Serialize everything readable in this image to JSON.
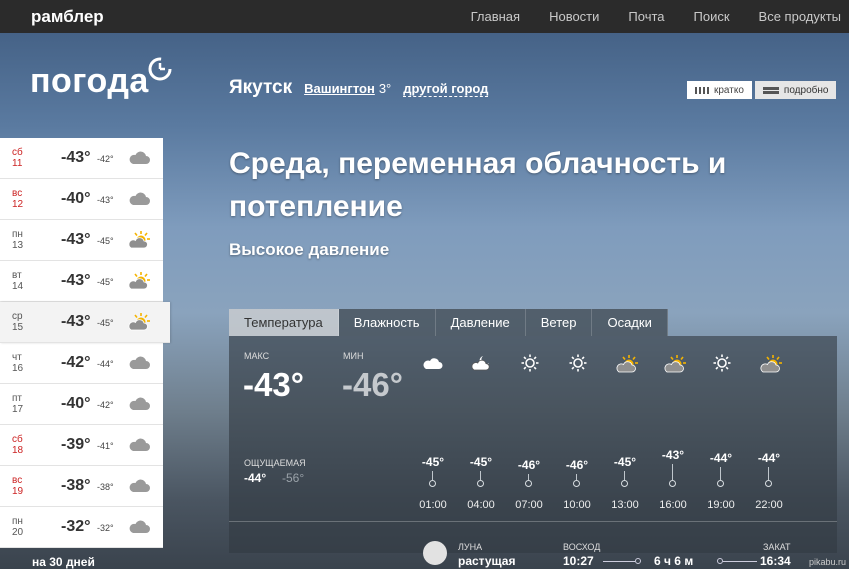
{
  "topbar": {
    "brand": "рамблер",
    "nav": [
      "Главная",
      "Новости",
      "Почта",
      "Поиск",
      "Все продукты"
    ]
  },
  "logo": "погода",
  "location": {
    "city": "Якутск",
    "alt_city": "Вашингтон",
    "alt_temp": "3°",
    "other_city": "другой город"
  },
  "view_toggle": {
    "short": "кратко",
    "detailed": "подробно"
  },
  "headline": "Среда, переменная облачность и потепление",
  "pressure_note": "Высокое давление",
  "days": [
    {
      "day": "сб",
      "date": "11",
      "max": "-43°",
      "min": "-42°",
      "icon": "cloud-icon",
      "weekend": true
    },
    {
      "day": "вс",
      "date": "12",
      "max": "-40°",
      "min": "-43°",
      "icon": "cloud-icon",
      "weekend": true
    },
    {
      "day": "пн",
      "date": "13",
      "max": "-43°",
      "min": "-45°",
      "icon": "partly-sunny-icon",
      "weekend": false
    },
    {
      "day": "вт",
      "date": "14",
      "max": "-43°",
      "min": "-45°",
      "icon": "partly-sunny-icon",
      "weekend": false
    },
    {
      "day": "ср",
      "date": "15",
      "max": "-43°",
      "min": "-45°",
      "icon": "partly-sunny-icon",
      "weekend": false
    },
    {
      "day": "чт",
      "date": "16",
      "max": "-42°",
      "min": "-44°",
      "icon": "cloud-icon",
      "weekend": false
    },
    {
      "day": "пт",
      "date": "17",
      "max": "-40°",
      "min": "-42°",
      "icon": "cloud-icon",
      "weekend": false
    },
    {
      "day": "сб",
      "date": "18",
      "max": "-39°",
      "min": "-41°",
      "icon": "cloud-icon",
      "weekend": true
    },
    {
      "day": "вс",
      "date": "19",
      "max": "-38°",
      "min": "-38°",
      "icon": "cloud-icon",
      "weekend": true
    },
    {
      "day": "пн",
      "date": "20",
      "max": "-32°",
      "min": "-32°",
      "icon": "cloud-icon",
      "weekend": false
    }
  ],
  "active_day_index": 4,
  "month_link": "на 30 дней",
  "tabs": [
    "Температура",
    "Влажность",
    "Давление",
    "Ветер",
    "Осадки"
  ],
  "panel": {
    "max_label": "МАКС",
    "max_value": "-43°",
    "min_label": "МИН",
    "min_value": "-46°",
    "feels_label": "ОЩУЩАЕМАЯ",
    "feels_max": "-44°",
    "feels_min": "-56°"
  },
  "hourly": [
    {
      "time": "01:00",
      "temp": "-45°",
      "icon": "cloud-night-icon"
    },
    {
      "time": "04:00",
      "temp": "-45°",
      "icon": "moon-cloud-icon"
    },
    {
      "time": "07:00",
      "temp": "-46°",
      "icon": "sun-icon"
    },
    {
      "time": "10:00",
      "temp": "-46°",
      "icon": "sun-icon"
    },
    {
      "time": "13:00",
      "temp": "-45°",
      "icon": "partly-sunny-icon"
    },
    {
      "time": "16:00",
      "temp": "-43°",
      "icon": "partly-sunny-icon"
    },
    {
      "time": "19:00",
      "temp": "-44°",
      "icon": "sun-icon"
    },
    {
      "time": "22:00",
      "temp": "-44°",
      "icon": "partly-sunny-icon"
    }
  ],
  "astro": {
    "moon_label": "ЛУНА",
    "moon_phase": "растущая",
    "sunrise_label": "ВОСХОД",
    "sunrise": "10:27",
    "day_length": "6 ч 6 м",
    "sunset_label": "ЗАКАТ",
    "sunset": "16:34"
  },
  "watermark": "pikabu.ru",
  "colors": {
    "weekend": "#cc2222",
    "sun": "#f5b400"
  }
}
